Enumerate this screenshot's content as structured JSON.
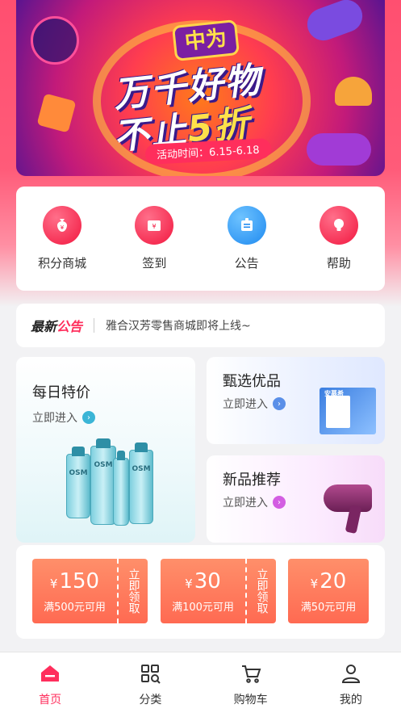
{
  "banner": {
    "logo": "中为",
    "headline_1": "万千好物",
    "headline_2_prefix": "不止",
    "headline_2_emph": "5折",
    "date": "活动时间：6.15-6.18"
  },
  "quick_menu": [
    {
      "label": "积分商城",
      "icon": "money-bag-icon",
      "color": "#f2173f"
    },
    {
      "label": "签到",
      "icon": "ticket-icon",
      "color": "#f2173f"
    },
    {
      "label": "公告",
      "icon": "notice-icon",
      "color": "#1f8af0"
    },
    {
      "label": "帮助",
      "icon": "lightbulb-icon",
      "color": "#f2173f"
    }
  ],
  "notice": {
    "tag_prefix": "最新",
    "tag_highlight": "公告",
    "text": "雅合汉芳零售商城即将上线~"
  },
  "promos": {
    "daily": {
      "title": "每日特价",
      "enter": "立即进入",
      "brand": "OSM"
    },
    "selected": {
      "title": "甄选优品",
      "enter": "立即进入",
      "brand": "安慕希"
    },
    "new": {
      "title": "新品推荐",
      "enter": "立即进入"
    }
  },
  "coupons": [
    {
      "currency": "¥",
      "amount": "150",
      "condition": "满500元可用",
      "claim": "立即领取"
    },
    {
      "currency": "¥",
      "amount": "30",
      "condition": "满100元可用",
      "claim": "立即领取"
    },
    {
      "currency": "¥",
      "amount": "20",
      "condition": "满50元可用"
    }
  ],
  "tabbar": [
    {
      "label": "首页",
      "icon": "home-icon",
      "active": true
    },
    {
      "label": "分类",
      "icon": "category-icon",
      "active": false
    },
    {
      "label": "购物车",
      "icon": "cart-icon",
      "active": false
    },
    {
      "label": "我的",
      "icon": "user-icon",
      "active": false
    }
  ],
  "colors": {
    "accent": "#ff2e5c",
    "coupon": "#ff7a5c"
  }
}
